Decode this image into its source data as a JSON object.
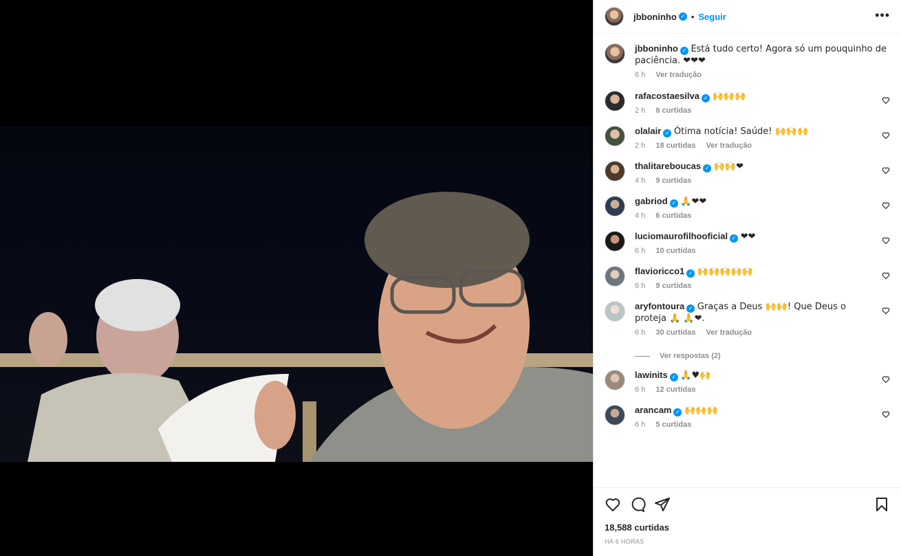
{
  "post": {
    "author": "jbboninho",
    "follow_label": "Seguir",
    "separator": "•",
    "more_label": "•••",
    "caption_text": "Está tudo certo! Agora só um pouquinho de paciência. ❤❤❤",
    "caption_time": "6 h",
    "caption_translate": "Ver tradução",
    "likes": "18,588 curtidas",
    "posted": "HÁ 6 HORAS"
  },
  "comments": [
    {
      "user": "rafacostaesilva",
      "text": "🙌🙌🙌",
      "time": "2 h",
      "likes": "8 curtidas",
      "translate": ""
    },
    {
      "user": "olalair",
      "text": "Ótima notícia! Saúde! 🙌🙌🙌",
      "time": "2 h",
      "likes": "18 curtidas",
      "translate": "Ver tradução"
    },
    {
      "user": "thalitareboucas",
      "text": "🙌🙌❤",
      "time": "4 h",
      "likes": "9 curtidas",
      "translate": ""
    },
    {
      "user": "gabriod",
      "text": "🙏❤❤",
      "time": "4 h",
      "likes": "6 curtidas",
      "translate": ""
    },
    {
      "user": "luciomaurofilhooficial",
      "text": "❤❤",
      "time": "6 h",
      "likes": "10 curtidas",
      "translate": ""
    },
    {
      "user": "flavioricco1",
      "text": "🙌🙌🙌🙌🙌",
      "time": "6 h",
      "likes": "9 curtidas",
      "translate": ""
    },
    {
      "user": "aryfontoura",
      "text": "Graças a Deus 🙌🙌! Que Deus o proteja 🙏 🙏❤.",
      "time": "6 h",
      "likes": "30 curtidas",
      "translate": "Ver tradução"
    },
    {
      "user": "lawinits",
      "text": "🙏♥🙌",
      "time": "6 h",
      "likes": "12 curtidas",
      "translate": ""
    },
    {
      "user": "arancam",
      "text": "🙌🙌🙌",
      "time": "6 h",
      "likes": "5 curtidas",
      "translate": ""
    }
  ],
  "replies_label": "Ver respostas (2)",
  "verified_mark": "✓",
  "colors": {
    "accent": "#0095f6",
    "heart": "#ed4956",
    "muted": "#8e8e8e"
  },
  "icons": [
    "heart-icon",
    "comment-icon",
    "share-icon",
    "bookmark-icon"
  ]
}
